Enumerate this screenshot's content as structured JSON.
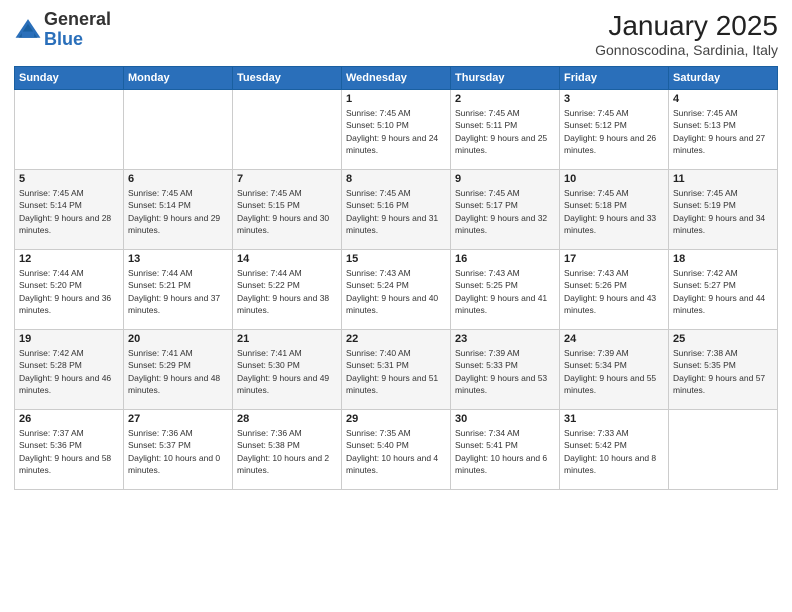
{
  "logo": {
    "general": "General",
    "blue": "Blue"
  },
  "title": "January 2025",
  "subtitle": "Gonnoscodina, Sardinia, Italy",
  "days_header": [
    "Sunday",
    "Monday",
    "Tuesday",
    "Wednesday",
    "Thursday",
    "Friday",
    "Saturday"
  ],
  "weeks": [
    [
      {
        "day": "",
        "sunrise": "",
        "sunset": "",
        "daylight": ""
      },
      {
        "day": "",
        "sunrise": "",
        "sunset": "",
        "daylight": ""
      },
      {
        "day": "",
        "sunrise": "",
        "sunset": "",
        "daylight": ""
      },
      {
        "day": "1",
        "sunrise": "Sunrise: 7:45 AM",
        "sunset": "Sunset: 5:10 PM",
        "daylight": "Daylight: 9 hours and 24 minutes."
      },
      {
        "day": "2",
        "sunrise": "Sunrise: 7:45 AM",
        "sunset": "Sunset: 5:11 PM",
        "daylight": "Daylight: 9 hours and 25 minutes."
      },
      {
        "day": "3",
        "sunrise": "Sunrise: 7:45 AM",
        "sunset": "Sunset: 5:12 PM",
        "daylight": "Daylight: 9 hours and 26 minutes."
      },
      {
        "day": "4",
        "sunrise": "Sunrise: 7:45 AM",
        "sunset": "Sunset: 5:13 PM",
        "daylight": "Daylight: 9 hours and 27 minutes."
      }
    ],
    [
      {
        "day": "5",
        "sunrise": "Sunrise: 7:45 AM",
        "sunset": "Sunset: 5:14 PM",
        "daylight": "Daylight: 9 hours and 28 minutes."
      },
      {
        "day": "6",
        "sunrise": "Sunrise: 7:45 AM",
        "sunset": "Sunset: 5:14 PM",
        "daylight": "Daylight: 9 hours and 29 minutes."
      },
      {
        "day": "7",
        "sunrise": "Sunrise: 7:45 AM",
        "sunset": "Sunset: 5:15 PM",
        "daylight": "Daylight: 9 hours and 30 minutes."
      },
      {
        "day": "8",
        "sunrise": "Sunrise: 7:45 AM",
        "sunset": "Sunset: 5:16 PM",
        "daylight": "Daylight: 9 hours and 31 minutes."
      },
      {
        "day": "9",
        "sunrise": "Sunrise: 7:45 AM",
        "sunset": "Sunset: 5:17 PM",
        "daylight": "Daylight: 9 hours and 32 minutes."
      },
      {
        "day": "10",
        "sunrise": "Sunrise: 7:45 AM",
        "sunset": "Sunset: 5:18 PM",
        "daylight": "Daylight: 9 hours and 33 minutes."
      },
      {
        "day": "11",
        "sunrise": "Sunrise: 7:45 AM",
        "sunset": "Sunset: 5:19 PM",
        "daylight": "Daylight: 9 hours and 34 minutes."
      }
    ],
    [
      {
        "day": "12",
        "sunrise": "Sunrise: 7:44 AM",
        "sunset": "Sunset: 5:20 PM",
        "daylight": "Daylight: 9 hours and 36 minutes."
      },
      {
        "day": "13",
        "sunrise": "Sunrise: 7:44 AM",
        "sunset": "Sunset: 5:21 PM",
        "daylight": "Daylight: 9 hours and 37 minutes."
      },
      {
        "day": "14",
        "sunrise": "Sunrise: 7:44 AM",
        "sunset": "Sunset: 5:22 PM",
        "daylight": "Daylight: 9 hours and 38 minutes."
      },
      {
        "day": "15",
        "sunrise": "Sunrise: 7:43 AM",
        "sunset": "Sunset: 5:24 PM",
        "daylight": "Daylight: 9 hours and 40 minutes."
      },
      {
        "day": "16",
        "sunrise": "Sunrise: 7:43 AM",
        "sunset": "Sunset: 5:25 PM",
        "daylight": "Daylight: 9 hours and 41 minutes."
      },
      {
        "day": "17",
        "sunrise": "Sunrise: 7:43 AM",
        "sunset": "Sunset: 5:26 PM",
        "daylight": "Daylight: 9 hours and 43 minutes."
      },
      {
        "day": "18",
        "sunrise": "Sunrise: 7:42 AM",
        "sunset": "Sunset: 5:27 PM",
        "daylight": "Daylight: 9 hours and 44 minutes."
      }
    ],
    [
      {
        "day": "19",
        "sunrise": "Sunrise: 7:42 AM",
        "sunset": "Sunset: 5:28 PM",
        "daylight": "Daylight: 9 hours and 46 minutes."
      },
      {
        "day": "20",
        "sunrise": "Sunrise: 7:41 AM",
        "sunset": "Sunset: 5:29 PM",
        "daylight": "Daylight: 9 hours and 48 minutes."
      },
      {
        "day": "21",
        "sunrise": "Sunrise: 7:41 AM",
        "sunset": "Sunset: 5:30 PM",
        "daylight": "Daylight: 9 hours and 49 minutes."
      },
      {
        "day": "22",
        "sunrise": "Sunrise: 7:40 AM",
        "sunset": "Sunset: 5:31 PM",
        "daylight": "Daylight: 9 hours and 51 minutes."
      },
      {
        "day": "23",
        "sunrise": "Sunrise: 7:39 AM",
        "sunset": "Sunset: 5:33 PM",
        "daylight": "Daylight: 9 hours and 53 minutes."
      },
      {
        "day": "24",
        "sunrise": "Sunrise: 7:39 AM",
        "sunset": "Sunset: 5:34 PM",
        "daylight": "Daylight: 9 hours and 55 minutes."
      },
      {
        "day": "25",
        "sunrise": "Sunrise: 7:38 AM",
        "sunset": "Sunset: 5:35 PM",
        "daylight": "Daylight: 9 hours and 57 minutes."
      }
    ],
    [
      {
        "day": "26",
        "sunrise": "Sunrise: 7:37 AM",
        "sunset": "Sunset: 5:36 PM",
        "daylight": "Daylight: 9 hours and 58 minutes."
      },
      {
        "day": "27",
        "sunrise": "Sunrise: 7:36 AM",
        "sunset": "Sunset: 5:37 PM",
        "daylight": "Daylight: 10 hours and 0 minutes."
      },
      {
        "day": "28",
        "sunrise": "Sunrise: 7:36 AM",
        "sunset": "Sunset: 5:38 PM",
        "daylight": "Daylight: 10 hours and 2 minutes."
      },
      {
        "day": "29",
        "sunrise": "Sunrise: 7:35 AM",
        "sunset": "Sunset: 5:40 PM",
        "daylight": "Daylight: 10 hours and 4 minutes."
      },
      {
        "day": "30",
        "sunrise": "Sunrise: 7:34 AM",
        "sunset": "Sunset: 5:41 PM",
        "daylight": "Daylight: 10 hours and 6 minutes."
      },
      {
        "day": "31",
        "sunrise": "Sunrise: 7:33 AM",
        "sunset": "Sunset: 5:42 PM",
        "daylight": "Daylight: 10 hours and 8 minutes."
      },
      {
        "day": "",
        "sunrise": "",
        "sunset": "",
        "daylight": ""
      }
    ]
  ]
}
